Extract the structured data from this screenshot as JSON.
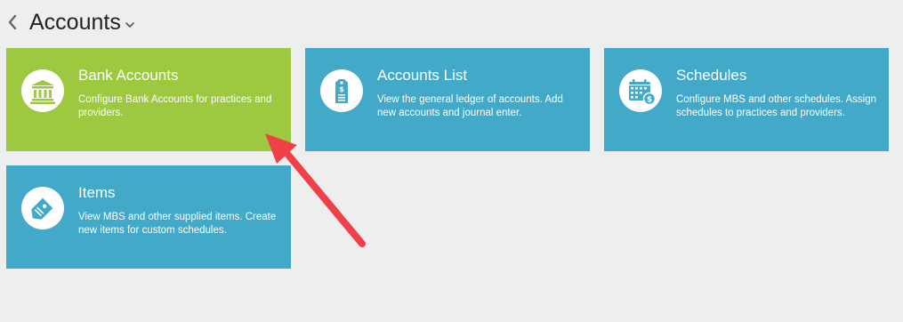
{
  "header": {
    "title": "Accounts"
  },
  "tiles": [
    {
      "title": "Bank Accounts",
      "description": "Configure Bank Accounts for practices and providers.",
      "icon": "bank-icon",
      "color": "#9cc93f"
    },
    {
      "title": "Accounts List",
      "description": "View the general ledger of accounts. Add new accounts and journal enter.",
      "icon": "ledger-tag-icon",
      "color": "#43a9c9"
    },
    {
      "title": "Schedules",
      "description": "Configure MBS and other schedules. Assign schedules to practices and providers.",
      "icon": "calendar-money-icon",
      "color": "#43a9c9"
    },
    {
      "title": "Items",
      "description": "View MBS and other supplied items. Create new items for custom schedules.",
      "icon": "price-tag-icon",
      "color": "#43a9c9"
    }
  ],
  "annotation": {
    "icon": "arrow-icon",
    "color": "#f0404a"
  }
}
